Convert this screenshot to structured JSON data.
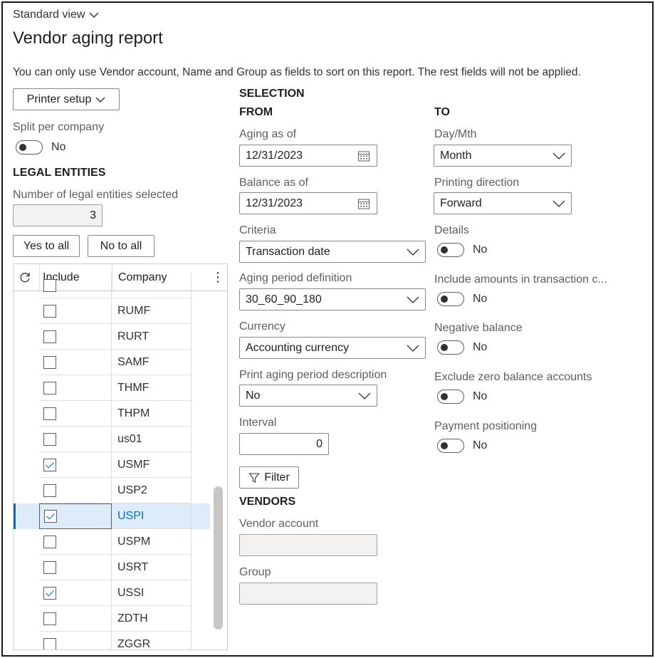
{
  "header": {
    "view_label": "Standard view",
    "title": "Vendor aging report",
    "info": "You can only use Vendor account, Name and Group as fields to sort on this report. The rest fields will not be applied."
  },
  "left": {
    "printer_setup": "Printer setup",
    "split_label": "Split per company",
    "split_value": "No",
    "legal_entities_heading": "LEGAL ENTITIES",
    "num_selected_label": "Number of legal entities selected",
    "num_selected_value": "3",
    "yes_to_all": "Yes to all",
    "no_to_all": "No to all"
  },
  "grid": {
    "columns": {
      "include": "Include",
      "company": "Company"
    },
    "rows": [
      {
        "company": "RUMF",
        "checked": false
      },
      {
        "company": "RURT",
        "checked": false
      },
      {
        "company": "SAMF",
        "checked": false
      },
      {
        "company": "THMF",
        "checked": false
      },
      {
        "company": "THPM",
        "checked": false
      },
      {
        "company": "us01",
        "checked": false
      },
      {
        "company": "USMF",
        "checked": true
      },
      {
        "company": "USP2",
        "checked": false
      },
      {
        "company": "USPI",
        "checked": true,
        "selected": true
      },
      {
        "company": "USPM",
        "checked": false
      },
      {
        "company": "USRT",
        "checked": false
      },
      {
        "company": "USSI",
        "checked": true
      },
      {
        "company": "ZDTH",
        "checked": false
      },
      {
        "company": "ZGGR",
        "checked": false
      }
    ]
  },
  "selection": {
    "heading": "SELECTION",
    "from": "FROM",
    "to": "TO",
    "aging_as_of_label": "Aging as of",
    "aging_as_of": "12/31/2023",
    "balance_as_of_label": "Balance as of",
    "balance_as_of": "12/31/2023",
    "criteria_label": "Criteria",
    "criteria": "Transaction date",
    "aging_period_label": "Aging period definition",
    "aging_period": "30_60_90_180",
    "currency_label": "Currency",
    "currency": "Accounting currency",
    "print_desc_label": "Print aging period description",
    "print_desc": "No",
    "interval_label": "Interval",
    "interval": "0",
    "filter": "Filter",
    "day_mth_label": "Day/Mth",
    "day_mth": "Month",
    "printing_direction_label": "Printing direction",
    "printing_direction": "Forward",
    "details_label": "Details",
    "details": "No",
    "include_amounts_label": "Include amounts in transaction c...",
    "include_amounts": "No",
    "negative_balance_label": "Negative balance",
    "negative_balance": "No",
    "exclude_zero_label": "Exclude zero balance accounts",
    "exclude_zero": "No",
    "payment_pos_label": "Payment positioning",
    "payment_pos": "No"
  },
  "vendors": {
    "heading": "VENDORS",
    "vendor_account_label": "Vendor account",
    "vendor_account": "",
    "group_label": "Group",
    "group": ""
  }
}
